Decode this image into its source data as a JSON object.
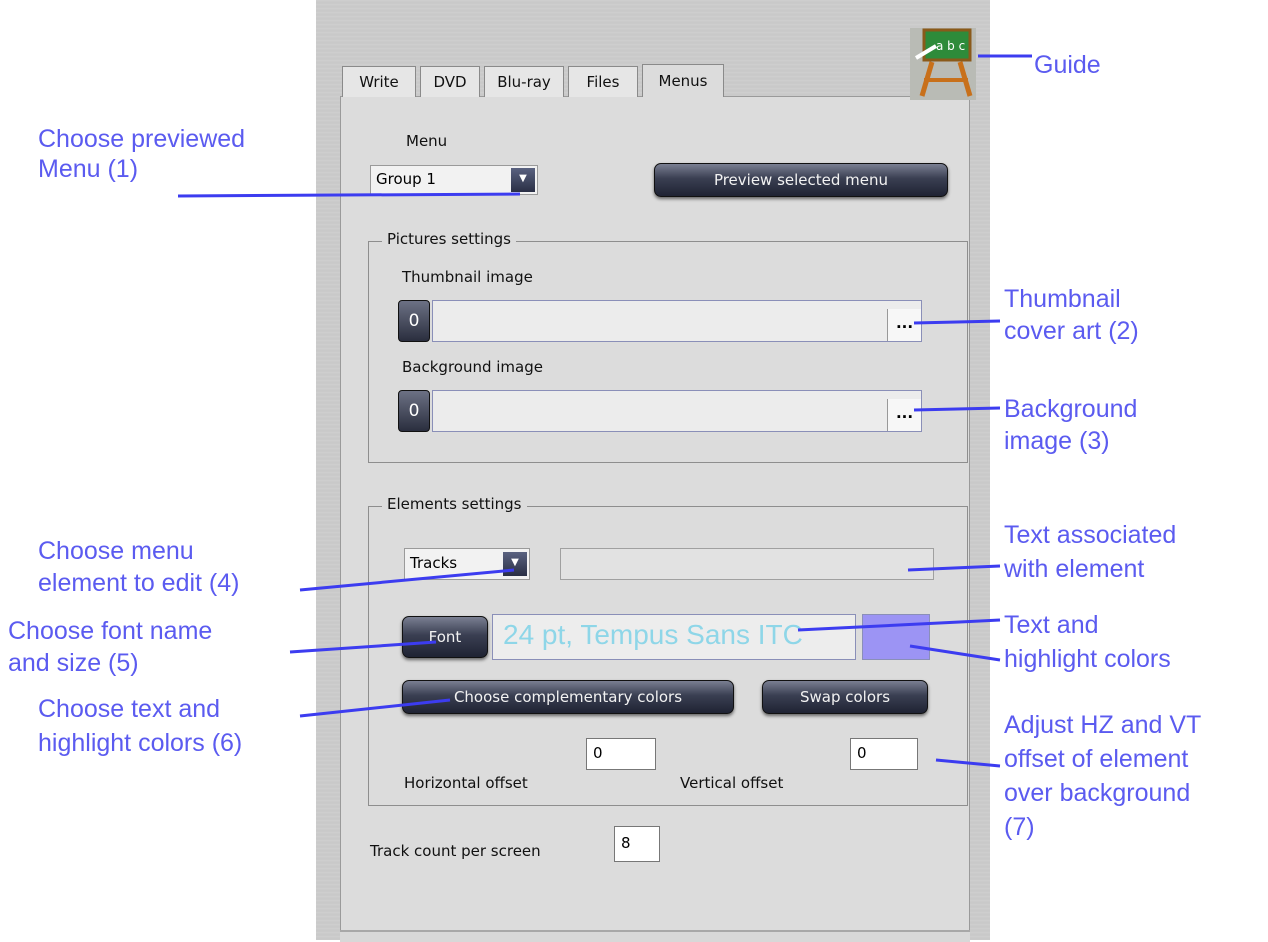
{
  "tabs": [
    "Write",
    "DVD",
    "Blu-ray",
    "Files",
    "Menus"
  ],
  "guide": {
    "icon": "chalkboard-icon",
    "board_text": "a b c"
  },
  "menu_section": {
    "label": "Menu",
    "selected": "Group 1",
    "preview_button": "Preview selected menu"
  },
  "pictures": {
    "legend": "Pictures settings",
    "thumbnail_label": "Thumbnail image",
    "thumbnail_badge": "0",
    "thumbnail_browse": "...",
    "background_label": "Background image",
    "background_badge": "0",
    "background_browse": "..."
  },
  "elements": {
    "legend": "Elements settings",
    "element_selected": "Tracks",
    "element_text": "",
    "font_button": "Font",
    "font_preview": "24 pt, Tempus Sans ITC",
    "swatch_color": "#9c94f4",
    "font_preview_color": "#8ed6e8",
    "complementary_button": "Choose complementary colors",
    "swap_button": "Swap colors",
    "horizontal_label": "Horizontal offset",
    "horizontal_value": "0",
    "vertical_label": "Vertical offset",
    "vertical_value": "0"
  },
  "track_count": {
    "label": "Track count per screen",
    "value": "8"
  },
  "callouts": {
    "guide": "Guide",
    "menu_1": "Choose previewed",
    "menu_2": "Menu (1)",
    "thumb_1": "Thumbnail",
    "thumb_2": "cover art (2)",
    "bg_1": "Background",
    "bg_2": "image (3)",
    "elem_1": "Choose menu",
    "elem_2": "element to edit (4)",
    "text_1": "Text associated",
    "text_2": "with element",
    "font_1": "Choose font name",
    "font_2": "and size (5)",
    "colors_1": "Text and",
    "colors_2": "highlight colors",
    "choose_1": "Choose text and",
    "choose_2": "highlight colors (6)",
    "offset_1": "Adjust HZ and VT",
    "offset_2": "offset of element",
    "offset_3": "over background",
    "offset_4": "(7)"
  },
  "colors": {
    "callout": "#5b5bf0",
    "line": "#3c3cf0"
  }
}
